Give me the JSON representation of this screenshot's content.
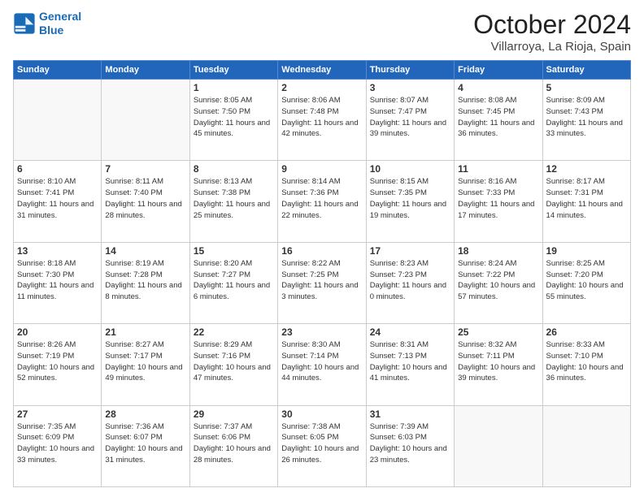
{
  "header": {
    "logo_line1": "General",
    "logo_line2": "Blue",
    "month_title": "October 2024",
    "location": "Villarroya, La Rioja, Spain"
  },
  "weekdays": [
    "Sunday",
    "Monday",
    "Tuesday",
    "Wednesday",
    "Thursday",
    "Friday",
    "Saturday"
  ],
  "weeks": [
    [
      {
        "day": "",
        "info": ""
      },
      {
        "day": "",
        "info": ""
      },
      {
        "day": "1",
        "info": "Sunrise: 8:05 AM\nSunset: 7:50 PM\nDaylight: 11 hours and 45 minutes."
      },
      {
        "day": "2",
        "info": "Sunrise: 8:06 AM\nSunset: 7:48 PM\nDaylight: 11 hours and 42 minutes."
      },
      {
        "day": "3",
        "info": "Sunrise: 8:07 AM\nSunset: 7:47 PM\nDaylight: 11 hours and 39 minutes."
      },
      {
        "day": "4",
        "info": "Sunrise: 8:08 AM\nSunset: 7:45 PM\nDaylight: 11 hours and 36 minutes."
      },
      {
        "day": "5",
        "info": "Sunrise: 8:09 AM\nSunset: 7:43 PM\nDaylight: 11 hours and 33 minutes."
      }
    ],
    [
      {
        "day": "6",
        "info": "Sunrise: 8:10 AM\nSunset: 7:41 PM\nDaylight: 11 hours and 31 minutes."
      },
      {
        "day": "7",
        "info": "Sunrise: 8:11 AM\nSunset: 7:40 PM\nDaylight: 11 hours and 28 minutes."
      },
      {
        "day": "8",
        "info": "Sunrise: 8:13 AM\nSunset: 7:38 PM\nDaylight: 11 hours and 25 minutes."
      },
      {
        "day": "9",
        "info": "Sunrise: 8:14 AM\nSunset: 7:36 PM\nDaylight: 11 hours and 22 minutes."
      },
      {
        "day": "10",
        "info": "Sunrise: 8:15 AM\nSunset: 7:35 PM\nDaylight: 11 hours and 19 minutes."
      },
      {
        "day": "11",
        "info": "Sunrise: 8:16 AM\nSunset: 7:33 PM\nDaylight: 11 hours and 17 minutes."
      },
      {
        "day": "12",
        "info": "Sunrise: 8:17 AM\nSunset: 7:31 PM\nDaylight: 11 hours and 14 minutes."
      }
    ],
    [
      {
        "day": "13",
        "info": "Sunrise: 8:18 AM\nSunset: 7:30 PM\nDaylight: 11 hours and 11 minutes."
      },
      {
        "day": "14",
        "info": "Sunrise: 8:19 AM\nSunset: 7:28 PM\nDaylight: 11 hours and 8 minutes."
      },
      {
        "day": "15",
        "info": "Sunrise: 8:20 AM\nSunset: 7:27 PM\nDaylight: 11 hours and 6 minutes."
      },
      {
        "day": "16",
        "info": "Sunrise: 8:22 AM\nSunset: 7:25 PM\nDaylight: 11 hours and 3 minutes."
      },
      {
        "day": "17",
        "info": "Sunrise: 8:23 AM\nSunset: 7:23 PM\nDaylight: 11 hours and 0 minutes."
      },
      {
        "day": "18",
        "info": "Sunrise: 8:24 AM\nSunset: 7:22 PM\nDaylight: 10 hours and 57 minutes."
      },
      {
        "day": "19",
        "info": "Sunrise: 8:25 AM\nSunset: 7:20 PM\nDaylight: 10 hours and 55 minutes."
      }
    ],
    [
      {
        "day": "20",
        "info": "Sunrise: 8:26 AM\nSunset: 7:19 PM\nDaylight: 10 hours and 52 minutes."
      },
      {
        "day": "21",
        "info": "Sunrise: 8:27 AM\nSunset: 7:17 PM\nDaylight: 10 hours and 49 minutes."
      },
      {
        "day": "22",
        "info": "Sunrise: 8:29 AM\nSunset: 7:16 PM\nDaylight: 10 hours and 47 minutes."
      },
      {
        "day": "23",
        "info": "Sunrise: 8:30 AM\nSunset: 7:14 PM\nDaylight: 10 hours and 44 minutes."
      },
      {
        "day": "24",
        "info": "Sunrise: 8:31 AM\nSunset: 7:13 PM\nDaylight: 10 hours and 41 minutes."
      },
      {
        "day": "25",
        "info": "Sunrise: 8:32 AM\nSunset: 7:11 PM\nDaylight: 10 hours and 39 minutes."
      },
      {
        "day": "26",
        "info": "Sunrise: 8:33 AM\nSunset: 7:10 PM\nDaylight: 10 hours and 36 minutes."
      }
    ],
    [
      {
        "day": "27",
        "info": "Sunrise: 7:35 AM\nSunset: 6:09 PM\nDaylight: 10 hours and 33 minutes."
      },
      {
        "day": "28",
        "info": "Sunrise: 7:36 AM\nSunset: 6:07 PM\nDaylight: 10 hours and 31 minutes."
      },
      {
        "day": "29",
        "info": "Sunrise: 7:37 AM\nSunset: 6:06 PM\nDaylight: 10 hours and 28 minutes."
      },
      {
        "day": "30",
        "info": "Sunrise: 7:38 AM\nSunset: 6:05 PM\nDaylight: 10 hours and 26 minutes."
      },
      {
        "day": "31",
        "info": "Sunrise: 7:39 AM\nSunset: 6:03 PM\nDaylight: 10 hours and 23 minutes."
      },
      {
        "day": "",
        "info": ""
      },
      {
        "day": "",
        "info": ""
      }
    ]
  ]
}
